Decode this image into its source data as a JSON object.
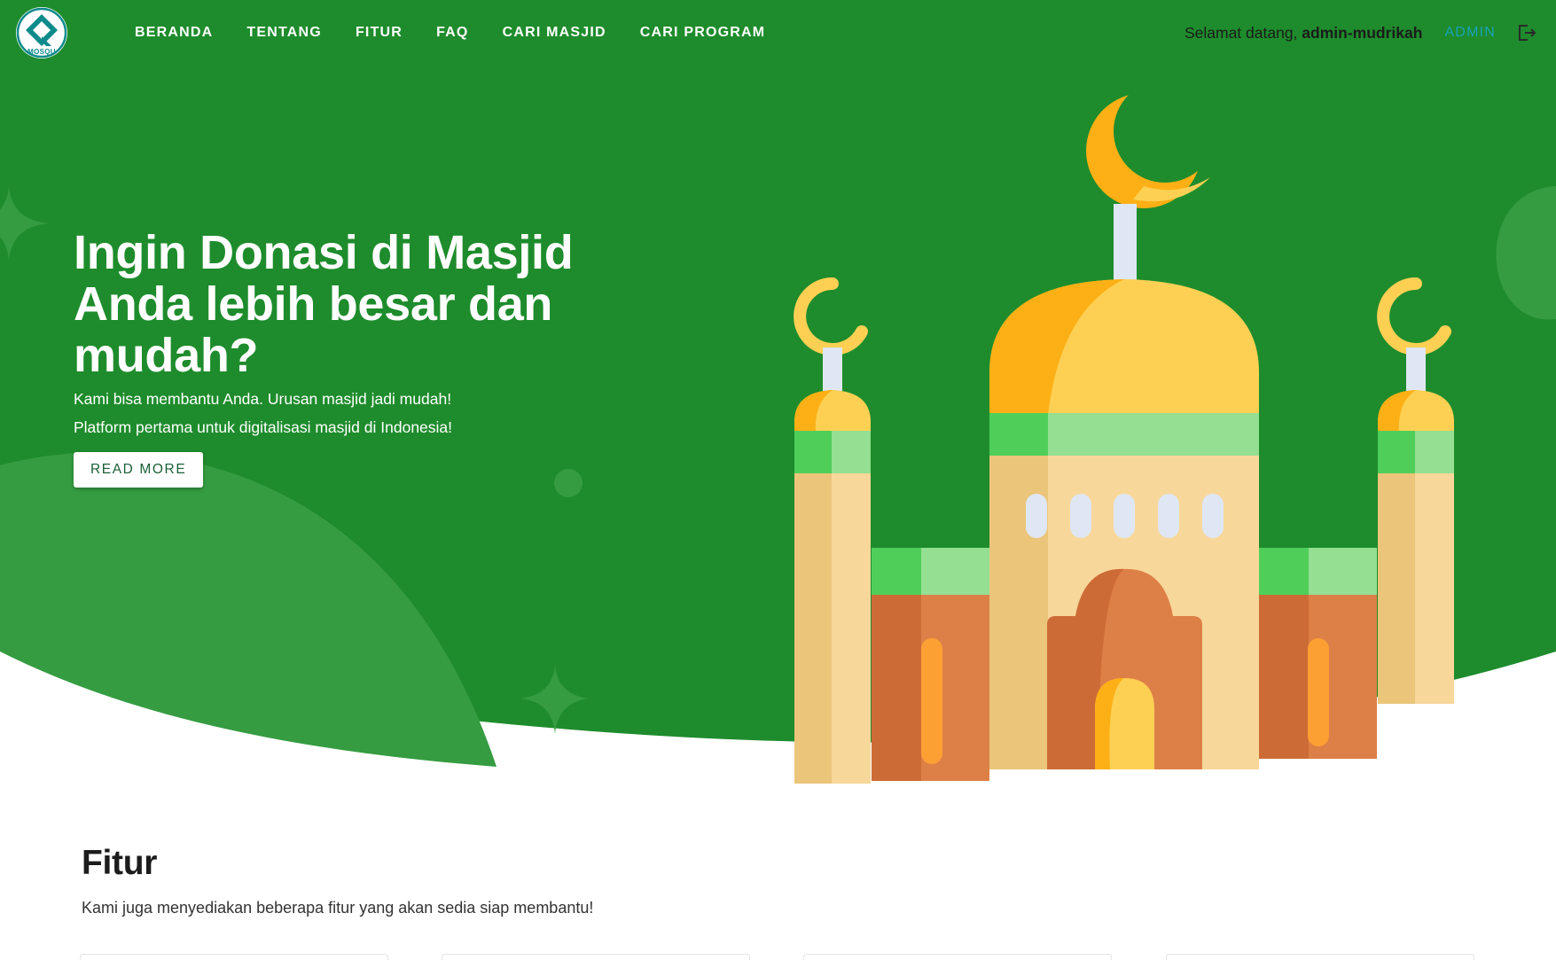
{
  "colors": {
    "hero_green": "#1e8c2c",
    "accent_teal": "#17a2b8",
    "dome_gold": "#fdd054",
    "trim_green": "#94df92"
  },
  "brand": {
    "logo_text": "MOSQU"
  },
  "nav": {
    "items": [
      {
        "label": "BERANDA"
      },
      {
        "label": "TENTANG"
      },
      {
        "label": "FITUR"
      },
      {
        "label": "FAQ"
      },
      {
        "label": "CARI MASJID"
      },
      {
        "label": "CARI PROGRAM"
      }
    ],
    "welcome_prefix": "Selamat datang,",
    "username": "admin-mudrikah",
    "admin_label": "ADMIN",
    "logout_icon": "logout-icon"
  },
  "hero": {
    "title_line1": "Ingin Donasi di Masjid",
    "title_line2": "Anda lebih besar dan",
    "title_line3": "mudah?",
    "subtitle_line1": "Kami bisa membantu Anda. Urusan masjid jadi mudah!",
    "subtitle_line2": "Platform pertama untuk digitalisasi masjid di Indonesia!",
    "button_label": "READ MORE"
  },
  "features": {
    "title": "Fitur",
    "subtitle": "Kami juga menyediakan beberapa fitur yang akan sedia siap membantu!"
  }
}
